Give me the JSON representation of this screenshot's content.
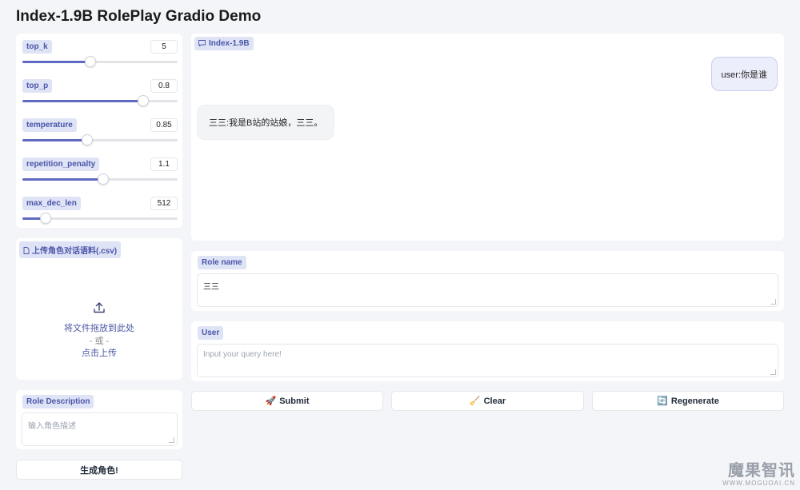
{
  "app": {
    "title": "Index-1.9B RolePlay Gradio Demo"
  },
  "sliders": [
    {
      "label": "top_k",
      "value": "5",
      "fraction": 0.44
    },
    {
      "label": "top_p",
      "value": "0.8",
      "fraction": 0.78
    },
    {
      "label": "temperature",
      "value": "0.85",
      "fraction": 0.42
    },
    {
      "label": "repetition_penalty",
      "value": "1.1",
      "fraction": 0.52
    },
    {
      "label": "max_dec_len",
      "value": "512",
      "fraction": 0.15
    }
  ],
  "upload": {
    "label": "上传角色对话语料(.csv)",
    "drop_text": "将文件拖放到此处",
    "or_text": "- 或 -",
    "click_text": "点击上传"
  },
  "role_description": {
    "label": "Role Description",
    "placeholder": "输入角色描述"
  },
  "generate_button": "生成角色!",
  "chat": {
    "label": "Index-1.9B",
    "messages": [
      {
        "role": "user",
        "text": "user:你是谁"
      },
      {
        "role": "bot",
        "text": "三三:我是B站的站娘，三三。"
      }
    ]
  },
  "role_name": {
    "label": "Role name",
    "value": "三三"
  },
  "user_input": {
    "label": "User",
    "placeholder": "Input your query here!"
  },
  "actions": {
    "submit": {
      "icon": "rocket-icon",
      "label": "Submit",
      "glyph": "🚀"
    },
    "clear": {
      "icon": "broom-icon",
      "label": "Clear",
      "glyph": "🧹"
    },
    "regenerate": {
      "icon": "refresh-icon",
      "label": "Regenerate",
      "glyph": "🔄"
    }
  },
  "watermark": {
    "main": "魔果智讯",
    "sub": "WWW.MOGUOAI.CN"
  },
  "colors": {
    "accent": "#5f69c2",
    "tag_bg": "#dfe3f6",
    "tag_text": "#4a55a8"
  }
}
